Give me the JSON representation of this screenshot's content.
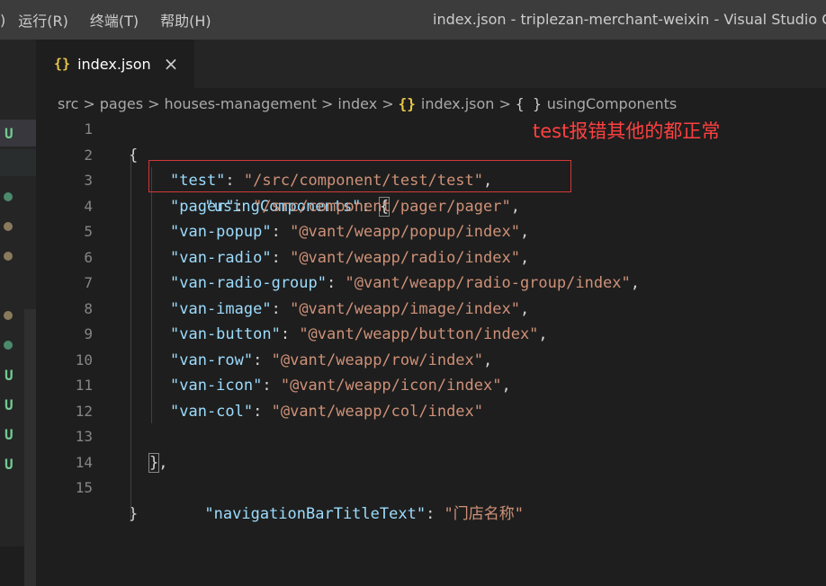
{
  "menu": {
    "paren": ")",
    "run": "运行(R)",
    "terminal": "终端(T)",
    "help": "帮助(H)"
  },
  "window_title": "index.json - triplezan-merchant-weixin - Visual Studio C",
  "tab": {
    "icon": "{}",
    "label": "index.json",
    "close": "×"
  },
  "breadcrumb": {
    "items": [
      "src",
      "pages",
      "houses-management",
      "index"
    ],
    "json_icon": "{}",
    "file": "index.json",
    "obj_icon": "{ }",
    "symbol": "usingComponents"
  },
  "scm": {
    "status_u": "U"
  },
  "annotation": "test报错其他的都正常",
  "code": {
    "line_numbers": [
      "1",
      "2",
      "3",
      "4",
      "5",
      "6",
      "7",
      "8",
      "9",
      "10",
      "11",
      "12",
      "13",
      "14",
      "15"
    ],
    "open_brace": "{",
    "using_key": "\"usingComponents\"",
    "using_colon": ": ",
    "using_open": "{",
    "entries": [
      {
        "key": "\"test\"",
        "value": "\"/src/component/test/test\"",
        "comma": ","
      },
      {
        "key": "\"pager\"",
        "value": "\"/src/component/pager/pager\"",
        "comma": ","
      },
      {
        "key": "\"van-popup\"",
        "value": "\"@vant/weapp/popup/index\"",
        "comma": ","
      },
      {
        "key": "\"van-radio\"",
        "value": "\"@vant/weapp/radio/index\"",
        "comma": ","
      },
      {
        "key": "\"van-radio-group\"",
        "value": "\"@vant/weapp/radio-group/index\"",
        "comma": ","
      },
      {
        "key": "\"van-image\"",
        "value": "\"@vant/weapp/image/index\"",
        "comma": ","
      },
      {
        "key": "\"van-button\"",
        "value": "\"@vant/weapp/button/index\"",
        "comma": ","
      },
      {
        "key": "\"van-row\"",
        "value": "\"@vant/weapp/row/index\"",
        "comma": ","
      },
      {
        "key": "\"van-icon\"",
        "value": "\"@vant/weapp/icon/index\"",
        "comma": ","
      },
      {
        "key": "\"van-col\"",
        "value": "\"@vant/weapp/col/index\"",
        "comma": ""
      }
    ],
    "using_close": "},",
    "nav_key": "\"navigationBarTitleText\"",
    "nav_colon": ": ",
    "nav_value": "\"门店名称\"",
    "close_brace": "}"
  },
  "colors": {
    "key": "#9cdcfe",
    "string": "#ce9178",
    "annotation": "#ff4040",
    "json_icon": "#e8c547",
    "scm_untracked": "#73c991"
  }
}
